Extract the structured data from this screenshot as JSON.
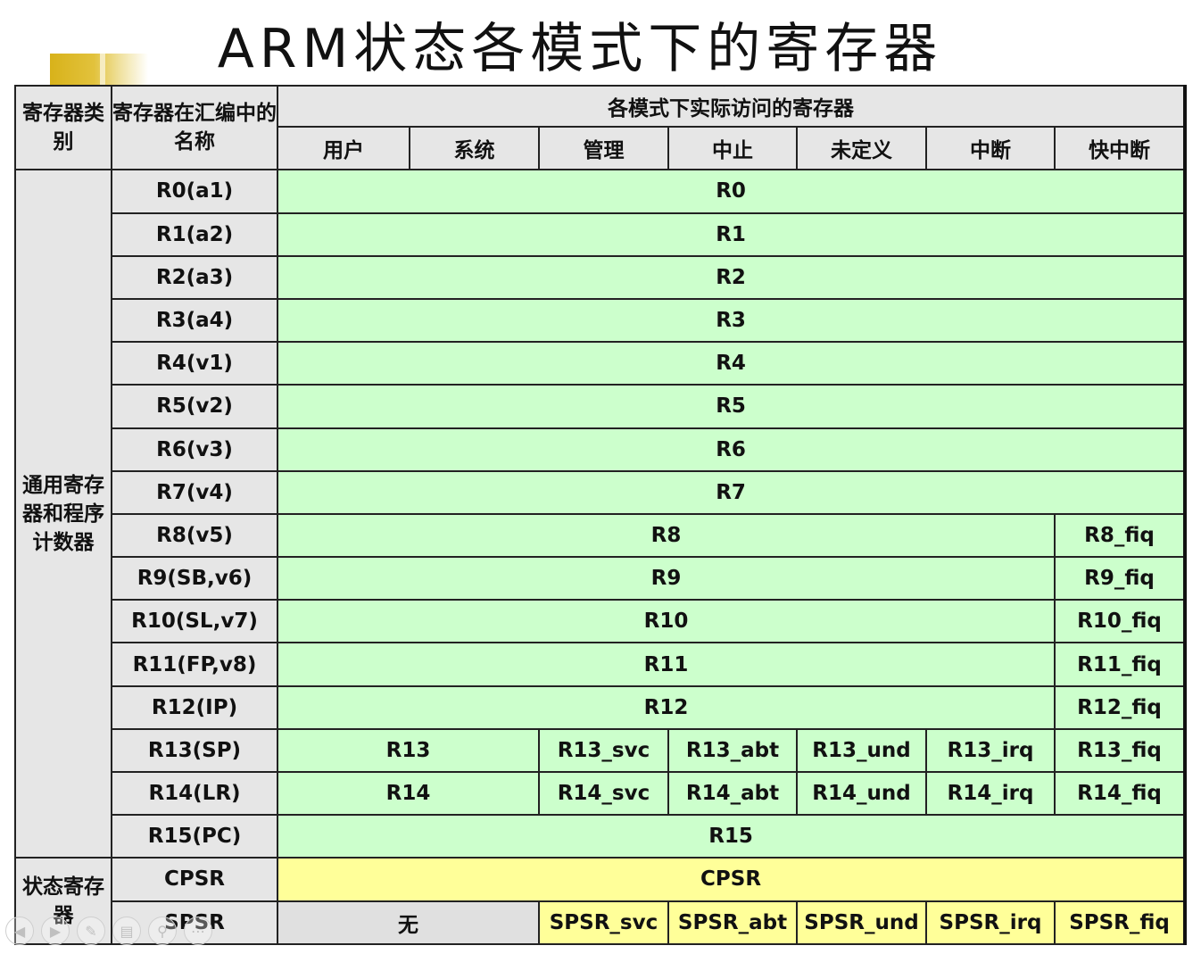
{
  "title": "ARM状态各模式下的寄存器",
  "header": {
    "category": "寄存器类别",
    "asm_name": "寄存器在汇编中的名称",
    "modes_group": "各模式下实际访问的寄存器",
    "modes": [
      "用户",
      "系统",
      "管理",
      "中止",
      "未定义",
      "中断",
      "快中断"
    ]
  },
  "categories": {
    "general": "通用寄存器和程序计数器",
    "status": "状态寄存器"
  },
  "rows": {
    "r0": {
      "name": "R0(a1)",
      "shared": "R0"
    },
    "r1": {
      "name": "R1(a2)",
      "shared": "R1"
    },
    "r2": {
      "name": "R2(a3)",
      "shared": "R2"
    },
    "r3": {
      "name": "R3(a4)",
      "shared": "R3"
    },
    "r4": {
      "name": "R4(v1)",
      "shared": "R4"
    },
    "r5": {
      "name": "R5(v2)",
      "shared": "R5"
    },
    "r6": {
      "name": "R6(v3)",
      "shared": "R6"
    },
    "r7": {
      "name": "R7(v4)",
      "shared": "R7"
    },
    "r8": {
      "name": "R8(v5)",
      "shared": "R8",
      "fiq": "R8_fiq"
    },
    "r9": {
      "name": "R9(SB,v6)",
      "shared": "R9",
      "fiq": "R9_fiq"
    },
    "r10": {
      "name": "R10(SL,v7)",
      "shared": "R10",
      "fiq": "R10_fiq"
    },
    "r11": {
      "name": "R11(FP,v8)",
      "shared": "R11",
      "fiq": "R11_fiq"
    },
    "r12": {
      "name": "R12(IP)",
      "shared": "R12",
      "fiq": "R12_fiq"
    },
    "r13": {
      "name": "R13(SP)",
      "user_sys": "R13",
      "svc": "R13_svc",
      "abt": "R13_abt",
      "und": "R13_und",
      "irq": "R13_irq",
      "fiq": "R13_fiq"
    },
    "r14": {
      "name": "R14(LR)",
      "user_sys": "R14",
      "svc": "R14_svc",
      "abt": "R14_abt",
      "und": "R14_und",
      "irq": "R14_irq",
      "fiq": "R14_fiq"
    },
    "r15": {
      "name": "R15(PC)",
      "shared": "R15"
    },
    "cpsr": {
      "name": "CPSR",
      "shared": "CPSR"
    },
    "spsr": {
      "name": "SPSR",
      "user_sys": "无",
      "svc": "SPSR_svc",
      "abt": "SPSR_abt",
      "und": "SPSR_und",
      "irq": "SPSR_irq",
      "fiq": "SPSR_fiq"
    }
  },
  "colors": {
    "header_bg": "#e6e6e6",
    "general_cell_bg": "#ccffcc",
    "status_cell_bg": "#ffff99",
    "none_cell_bg": "#e0e0e0"
  },
  "nav_icons": [
    "back-icon",
    "forward-icon",
    "pen-icon",
    "slides-icon",
    "zoom-icon",
    "more-icon"
  ]
}
